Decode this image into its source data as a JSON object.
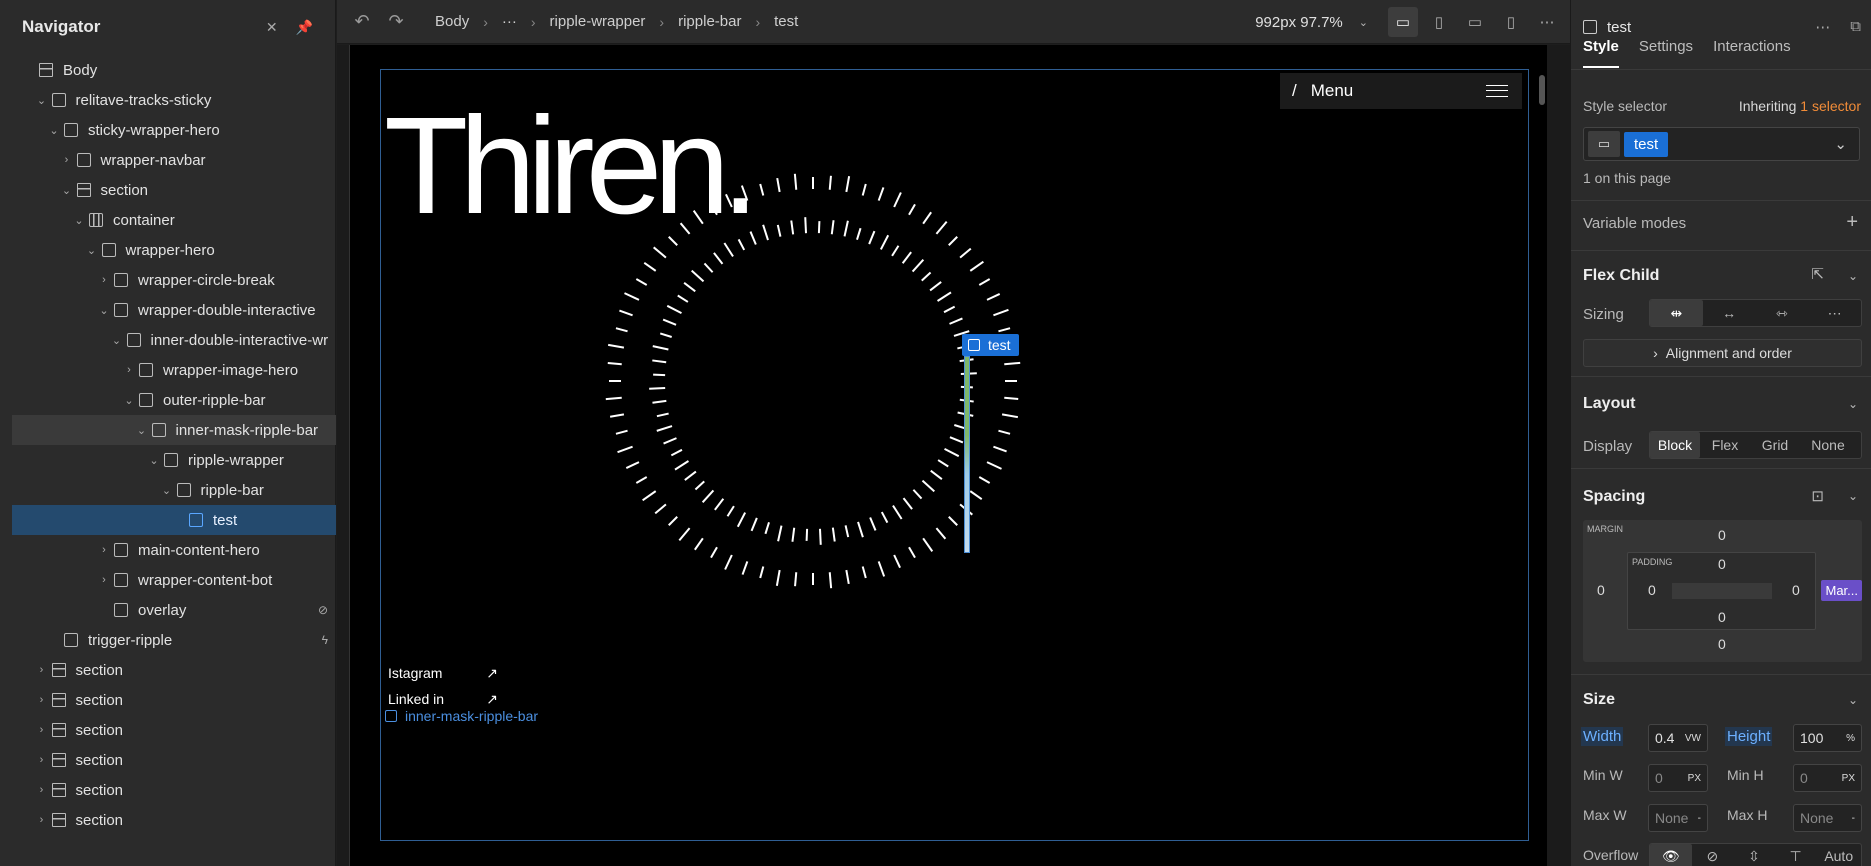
{
  "navigator": {
    "title": "Navigator",
    "icons": [
      "collapse-icon",
      "pin-icon"
    ],
    "items": [
      {
        "label": "Body",
        "depth": 0,
        "chevron": "",
        "icon": "body"
      },
      {
        "label": "relitave-tracks-sticky",
        "depth": 1,
        "chevron": "open",
        "icon": "div"
      },
      {
        "label": "sticky-wrapper-hero",
        "depth": 2,
        "chevron": "open",
        "icon": "div"
      },
      {
        "label": "wrapper-navbar",
        "depth": 3,
        "chevron": "closed",
        "icon": "div"
      },
      {
        "label": "section",
        "depth": 3,
        "chevron": "open",
        "icon": "section"
      },
      {
        "label": "container",
        "depth": 4,
        "chevron": "open",
        "icon": "container"
      },
      {
        "label": "wrapper-hero",
        "depth": 5,
        "chevron": "open",
        "icon": "div"
      },
      {
        "label": "wrapper-circle-break",
        "depth": 6,
        "chevron": "closed",
        "icon": "div"
      },
      {
        "label": "wrapper-double-interactive",
        "depth": 6,
        "chevron": "open",
        "icon": "div"
      },
      {
        "label": "inner-double-interactive-wr",
        "depth": 7,
        "chevron": "open",
        "icon": "div"
      },
      {
        "label": "wrapper-image-hero",
        "depth": 8,
        "chevron": "closed",
        "icon": "div"
      },
      {
        "label": "outer-ripple-bar",
        "depth": 8,
        "chevron": "open",
        "icon": "div"
      },
      {
        "label": "inner-mask-ripple-bar",
        "depth": 9,
        "chevron": "open",
        "icon": "div",
        "state": "hover"
      },
      {
        "label": "ripple-wrapper",
        "depth": 10,
        "chevron": "open",
        "icon": "div"
      },
      {
        "label": "ripple-bar",
        "depth": 11,
        "chevron": "open",
        "icon": "div"
      },
      {
        "label": "test",
        "depth": 12,
        "chevron": "",
        "icon": "div",
        "state": "selected"
      },
      {
        "label": "main-content-hero",
        "depth": 6,
        "chevron": "closed",
        "icon": "div"
      },
      {
        "label": "wrapper-content-bot",
        "depth": 6,
        "chevron": "closed",
        "icon": "div"
      },
      {
        "label": "overlay",
        "depth": 6,
        "chevron": "",
        "icon": "div",
        "trail": "hidden-icon"
      },
      {
        "label": "trigger-ripple",
        "depth": 2,
        "chevron": "",
        "icon": "div",
        "trail": "lightning-icon"
      },
      {
        "label": "section",
        "depth": 1,
        "chevron": "closed",
        "icon": "section"
      },
      {
        "label": "section",
        "depth": 1,
        "chevron": "closed",
        "icon": "section"
      },
      {
        "label": "section",
        "depth": 1,
        "chevron": "closed",
        "icon": "section"
      },
      {
        "label": "section",
        "depth": 1,
        "chevron": "closed",
        "icon": "section"
      },
      {
        "label": "section",
        "depth": 1,
        "chevron": "closed",
        "icon": "section"
      },
      {
        "label": "section",
        "depth": 1,
        "chevron": "closed",
        "icon": "section"
      }
    ]
  },
  "toolbar": {
    "breadcrumbs": [
      "Body",
      "···",
      "ripple-wrapper",
      "ripple-bar",
      "test"
    ],
    "breakpoint": "992px 97.7%"
  },
  "canvas": {
    "logo": "Thiren.",
    "menu_slash": "/",
    "menu_label": "Menu",
    "selected_tag": "test",
    "social": [
      {
        "label": "Istagram"
      },
      {
        "label": "Linked in"
      }
    ],
    "hover_tag": "inner-mask-ripple-bar",
    "ripple_tick_count": 72
  },
  "panel": {
    "element_name": "test",
    "tabs": [
      "Style",
      "Settings",
      "Interactions"
    ],
    "style_selector_label": "Style selector",
    "inheriting_prefix": "Inheriting",
    "inheriting_count": "1 selector",
    "selector_chip": "test",
    "on_page": "1 on this page",
    "variable_modes": "Variable modes",
    "flex_child": {
      "title": "Flex Child",
      "sizing_label": "Sizing",
      "alignment": "Alignment and order"
    },
    "layout": {
      "title": "Layout",
      "display_label": "Display",
      "options": [
        "Block",
        "Flex",
        "Grid",
        "None"
      ],
      "active": "Block"
    },
    "spacing": {
      "title": "Spacing",
      "margin_label": "MARGIN",
      "padding_label": "PADDING",
      "margin": {
        "top": "0",
        "right": "Mar...",
        "bottom": "0",
        "left": "0"
      },
      "padding": {
        "top": "0",
        "right": "0",
        "bottom": "0",
        "left": "0"
      }
    },
    "size": {
      "title": "Size",
      "width_label": "Width",
      "width": "0.4",
      "width_unit": "VW",
      "height_label": "Height",
      "height": "100",
      "height_unit": "%",
      "minw_label": "Min W",
      "minw": "0",
      "minw_unit": "PX",
      "minh_label": "Min H",
      "minh": "0",
      "minh_unit": "PX",
      "maxw_label": "Max W",
      "maxw": "None",
      "maxw_unit": "-",
      "maxh_label": "Max H",
      "maxh": "None",
      "maxh_unit": "-",
      "overflow_label": "Overflow",
      "overflow_auto": "Auto"
    }
  },
  "colors": {
    "accent": "#1a6fd6",
    "selection_row": "#244a6e",
    "orange": "#f28c38",
    "margin_chip": "#6a4fc8"
  }
}
